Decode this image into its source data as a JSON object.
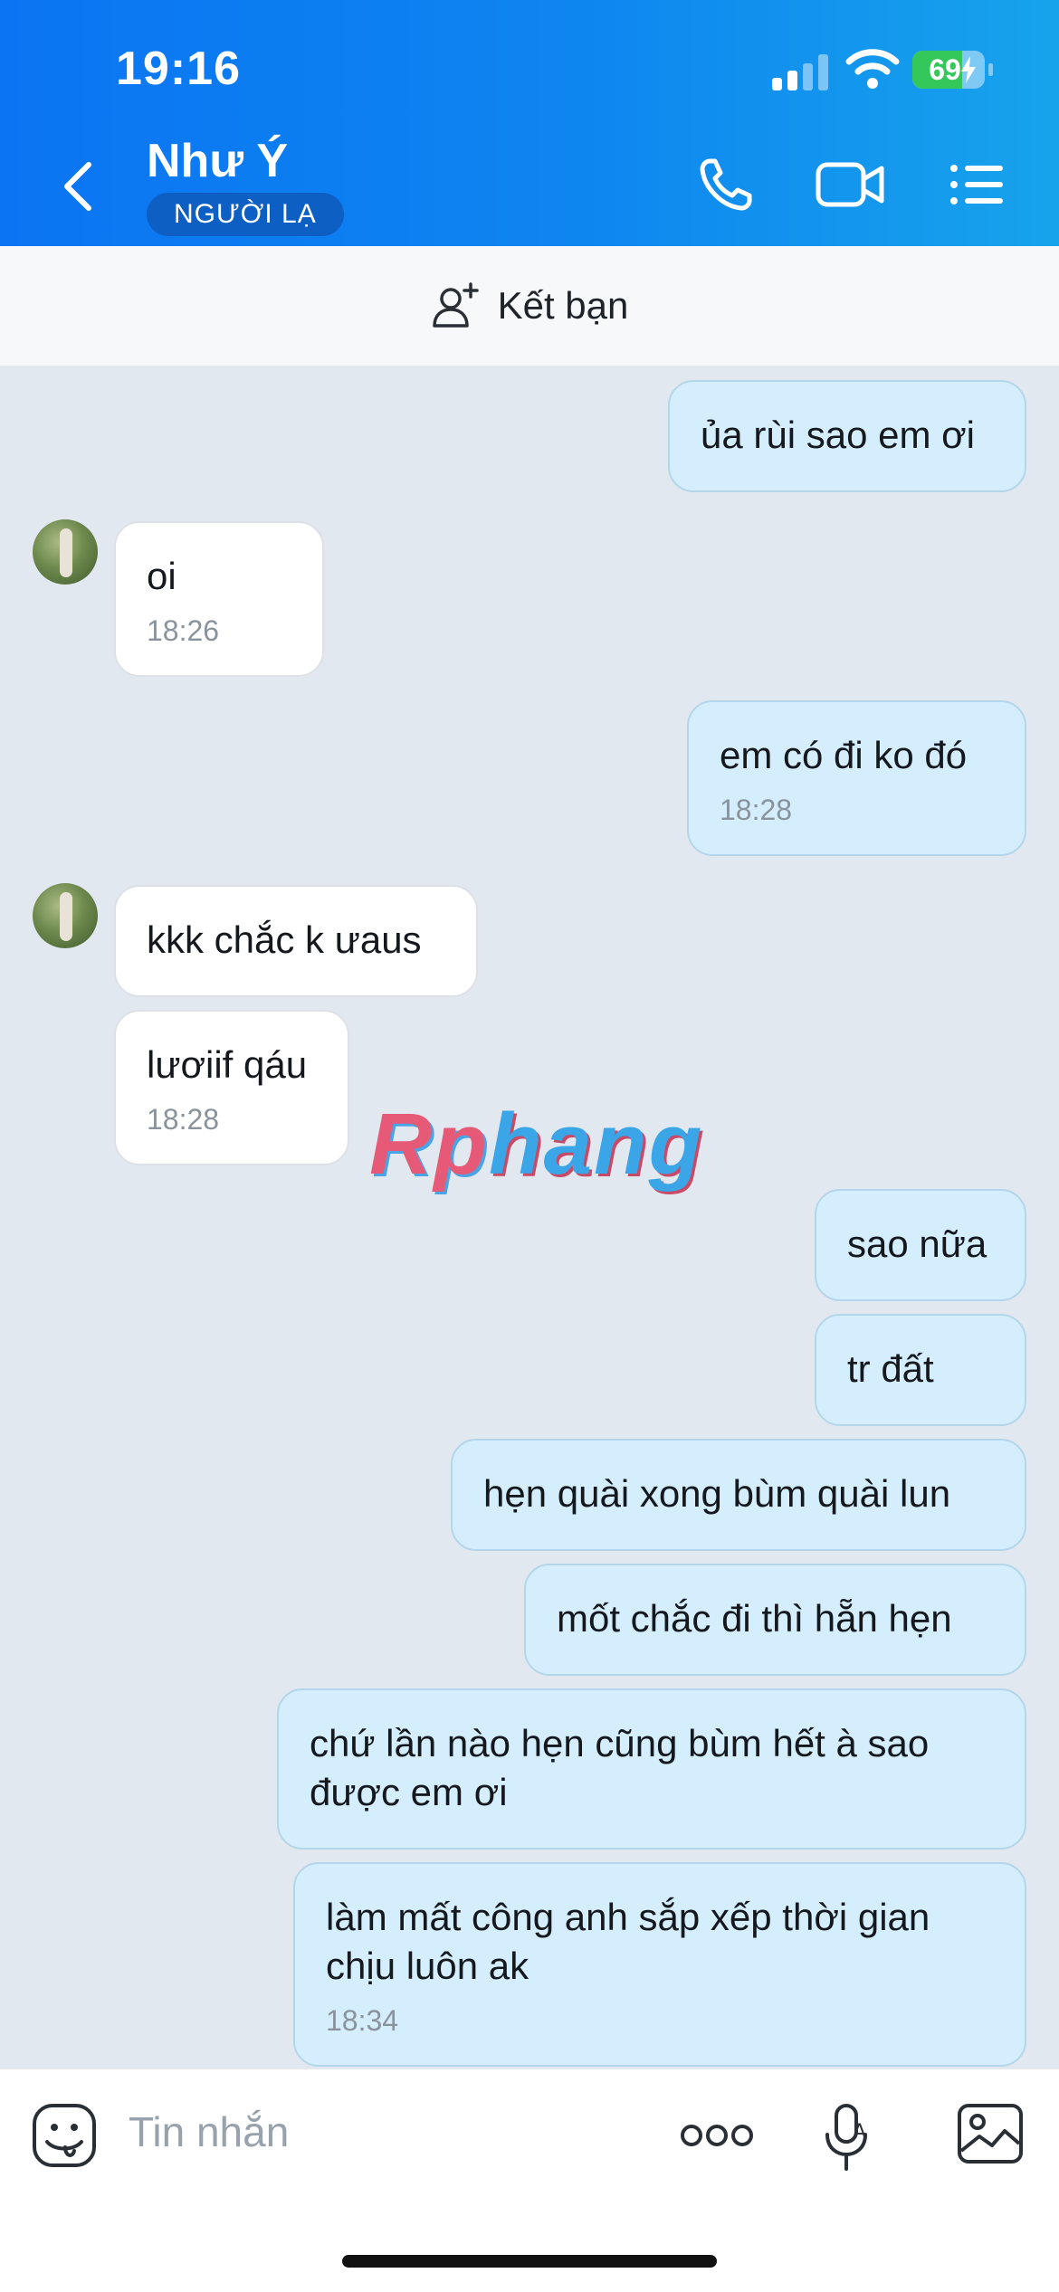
{
  "status_bar": {
    "time": "19:16",
    "battery": "69",
    "battery_level": 0.69
  },
  "header": {
    "name": "Như Ý",
    "badge": "NGƯỜI LẠ"
  },
  "add_friend": {
    "label": "Kết bạn"
  },
  "messages": [
    {
      "sender": "me",
      "text": "ủa rùi sao em ơi",
      "time": ""
    },
    {
      "sender": "them",
      "text": "oi",
      "time": "18:26"
    },
    {
      "sender": "me",
      "text": "em có đi ko đó",
      "time": "18:28"
    },
    {
      "sender": "them",
      "text": "kkk chắc k ưaus",
      "time": ""
    },
    {
      "sender": "them",
      "text": "lươiif qáu",
      "time": "18:28"
    },
    {
      "sender": "me",
      "text": "sao nữa",
      "time": ""
    },
    {
      "sender": "me",
      "text": "tr đất",
      "time": ""
    },
    {
      "sender": "me",
      "text": "hẹn quài xong bùm quài lun",
      "time": ""
    },
    {
      "sender": "me",
      "text": "mốt chắc đi thì hẵn hẹn",
      "time": ""
    },
    {
      "sender": "me",
      "text": "chứ lần nào hẹn cũng bùm hết à sao được em ơi",
      "time": ""
    },
    {
      "sender": "me",
      "text": "làm mất công anh sắp xếp thời gian chịu luôn ak",
      "time": "18:34"
    }
  ],
  "watermark": {
    "part1": "Rp",
    "part2": "hang"
  },
  "composer": {
    "placeholder": "Tin nhắn"
  },
  "icons": [
    "back-icon",
    "phone-icon",
    "video-call-icon",
    "menu-icon",
    "add-friend-icon",
    "sticker-icon",
    "more-icon",
    "voice-icon",
    "image-icon"
  ]
}
